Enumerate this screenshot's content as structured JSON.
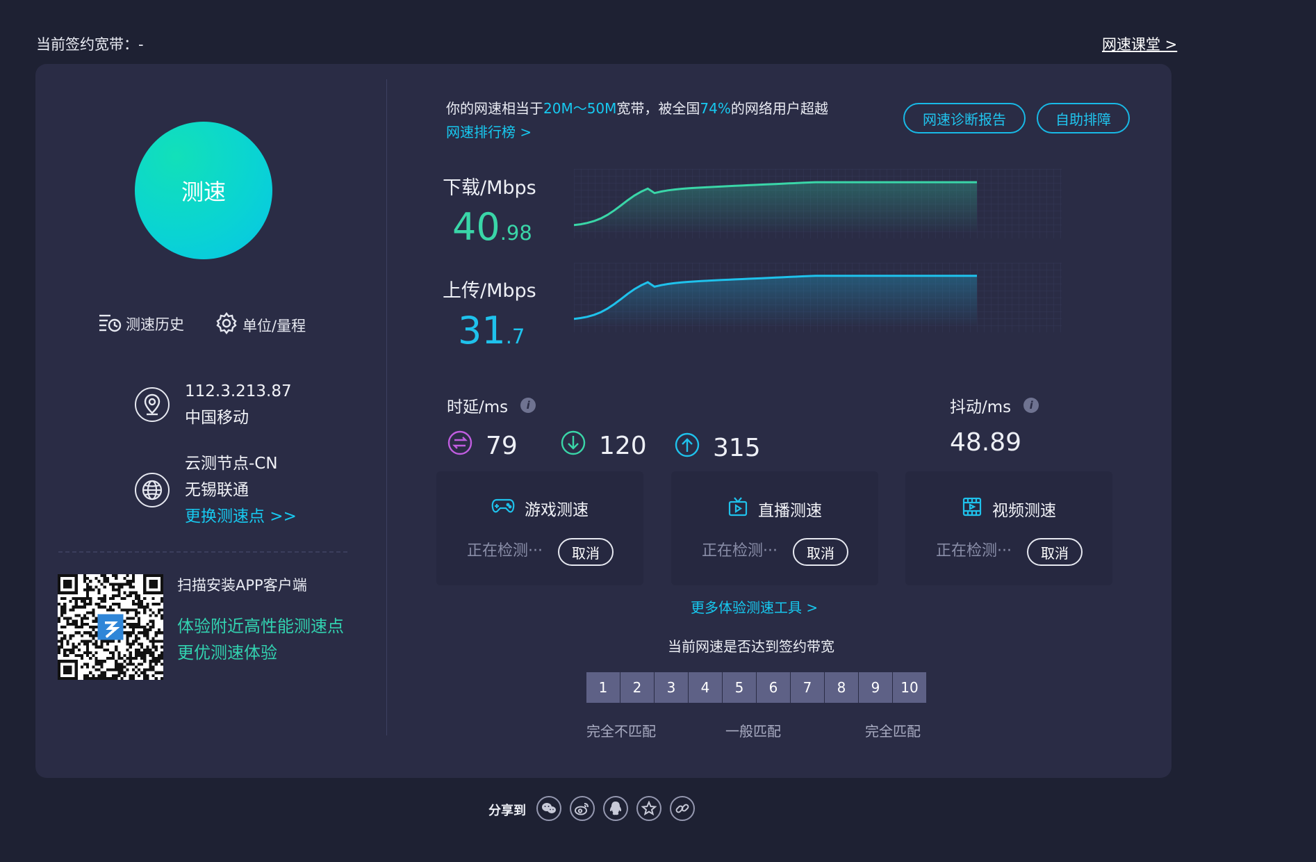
{
  "header": {
    "contract_label": "当前签约宽带：-",
    "course_link": "网速课堂 >"
  },
  "left": {
    "speed_button": "测速",
    "history_label": "测速历史",
    "unit_label": "单位/量程",
    "ip": "112.3.213.87",
    "isp": "中国移动",
    "node_name": "云测节点-CN",
    "node_isp": "无锡联通",
    "change_node": "更换测速点 >>",
    "qr_title": "扫描安装APP客户端",
    "qr_line1": "体验附近高性能测速点",
    "qr_line2": "更优测速体验"
  },
  "summary": {
    "prefix": "你的网速相当于",
    "bandwidth": "20M～50M",
    "middle": "宽带，被全国",
    "percent": "74%",
    "suffix": "的网络用户超越",
    "rank_link": "网速排行榜 >",
    "diag_button": "网速诊断报告",
    "self_help_button": "自助排障"
  },
  "download": {
    "label": "下载/Mbps",
    "int": "40",
    "dec": ".98",
    "color": "#3ad6a8"
  },
  "upload": {
    "label": "上传/Mbps",
    "int": "31",
    "dec": ".7",
    "color": "#1fc2ec"
  },
  "latency": {
    "label": "时延/ms",
    "idle": "79",
    "down": "120",
    "up": "315"
  },
  "jitter": {
    "label": "抖动/ms",
    "value": "48.89"
  },
  "cards": [
    {
      "title": "游戏测速",
      "status": "正在检测···",
      "cancel": "取消"
    },
    {
      "title": "直播测速",
      "status": "正在检测···",
      "cancel": "取消"
    },
    {
      "title": "视频测速",
      "status": "正在检测···",
      "cancel": "取消"
    }
  ],
  "more_tools": "更多体验测速工具 >",
  "match": {
    "question": "当前网速是否达到签约带宽",
    "scale": [
      "1",
      "2",
      "3",
      "4",
      "5",
      "6",
      "7",
      "8",
      "9",
      "10"
    ],
    "low": "完全不匹配",
    "mid": "一般匹配",
    "high": "完全匹配"
  },
  "share": {
    "label": "分享到"
  },
  "colors": {
    "accent_cyan": "#17c9f0",
    "accent_green": "#32d2b0",
    "latency_idle": "#c05de0"
  }
}
